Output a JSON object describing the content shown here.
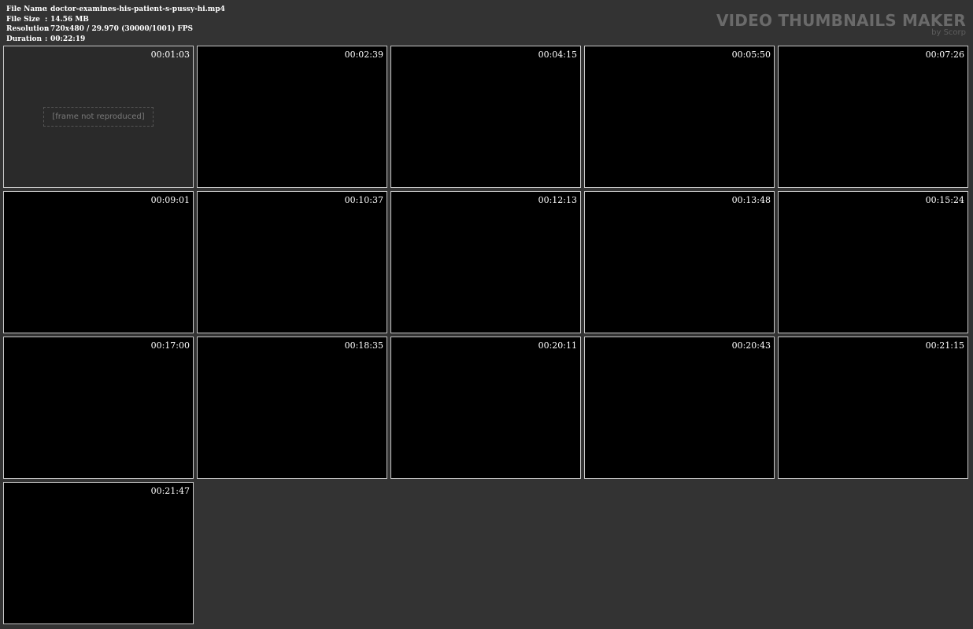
{
  "info": {
    "rows": [
      {
        "label": "File Name",
        "sep": ":",
        "value": "doctor-examines-his-patient-s-pussy-hi.mp4"
      },
      {
        "label": "File Size",
        "sep": ":",
        "value": "14.56 MB"
      },
      {
        "label": "Resolution",
        "sep": ":",
        "value": "720x480 / 29.970 (30000/1001) FPS"
      },
      {
        "label": "Duration",
        "sep": ":",
        "value": "00:22:19"
      }
    ]
  },
  "brand": {
    "title": "VIDEO THUMBNAILS MAKER",
    "subtitle": "by Scorp",
    "color": "#6a6a6a"
  },
  "thumbnails": [
    {
      "timestamp": "00:01:03"
    },
    {
      "timestamp": "00:02:39"
    },
    {
      "timestamp": "00:04:15"
    },
    {
      "timestamp": "00:05:50"
    },
    {
      "timestamp": "00:07:26"
    },
    {
      "timestamp": "00:09:01"
    },
    {
      "timestamp": "00:10:37"
    },
    {
      "timestamp": "00:12:13"
    },
    {
      "timestamp": "00:13:48"
    },
    {
      "timestamp": "00:15:24"
    },
    {
      "timestamp": "00:17:00"
    },
    {
      "timestamp": "00:18:35"
    },
    {
      "timestamp": "00:20:11"
    },
    {
      "timestamp": "00:20:43"
    },
    {
      "timestamp": "00:21:15"
    },
    {
      "timestamp": "00:21:47"
    }
  ],
  "placeholder_label": "[frame not reproduced]",
  "colors": {
    "background": "#333333",
    "thumb_border": "#c8c8c8",
    "thumb_fill": "#000000",
    "text": "#ffffff"
  }
}
